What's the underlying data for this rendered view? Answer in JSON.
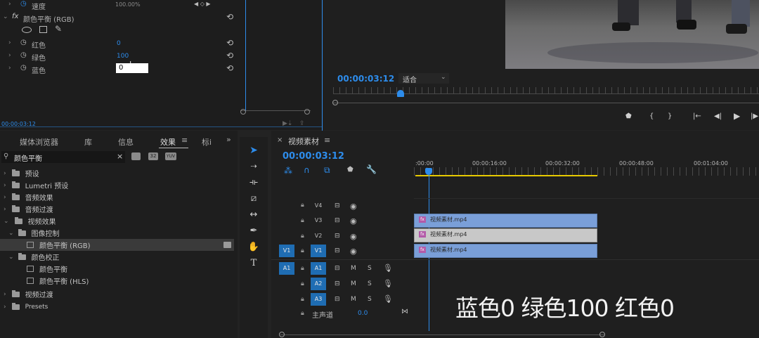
{
  "effect_controls": {
    "speed_label": "速度",
    "speed_value": "100.00%",
    "fx_name": "颜色平衡 (RGB)",
    "params": [
      {
        "label": "红色",
        "value": "0"
      },
      {
        "label": "绿色",
        "value": "100"
      },
      {
        "label": "蓝色",
        "value": "0"
      }
    ],
    "timecode": "00:00:03:12"
  },
  "program_monitor": {
    "timecode": "00:00:03:12",
    "fit_label": "适合"
  },
  "project_panel": {
    "tabs": [
      "媒体浏览器",
      "库",
      "信息",
      "效果",
      "标i"
    ],
    "search_value": "颜色平衡",
    "filter_icons": [
      "32",
      "YUV"
    ],
    "tree": [
      {
        "label": "预设",
        "indent": 0
      },
      {
        "label": "Lumetri 预设",
        "indent": 0
      },
      {
        "label": "音频效果",
        "indent": 0
      },
      {
        "label": "音频过渡",
        "indent": 0
      },
      {
        "label": "视频效果",
        "indent": 0
      },
      {
        "label": "图像控制",
        "indent": 1
      },
      {
        "label": "颜色平衡 (RGB)",
        "indent": 2
      },
      {
        "label": "颜色校正",
        "indent": 1
      },
      {
        "label": "颜色平衡",
        "indent": 2
      },
      {
        "label": "颜色平衡 (HLS)",
        "indent": 2
      },
      {
        "label": "视频过渡",
        "indent": 0
      },
      {
        "label": "Presets",
        "indent": 0
      }
    ]
  },
  "timeline": {
    "tab_title": "视频素材",
    "timecode": "00:00:03:12",
    "ruler": [
      ":00:00",
      "00:00:16:00",
      "00:00:32:00",
      "00:00:48:00",
      "00:01:04:00"
    ],
    "video_tracks": [
      "V4",
      "V3",
      "V2",
      "V1"
    ],
    "src_video": "V1",
    "audio_tracks": [
      "A1",
      "A2",
      "A3"
    ],
    "src_audio": "A1",
    "mute": "M",
    "solo": "S",
    "master_label": "主声道",
    "master_value": "0.0",
    "clips": [
      {
        "name": "视频素材.mp4",
        "color": "#7a9fd8"
      },
      {
        "name": "视频素材.mp4",
        "color": "#c8c8c8"
      },
      {
        "name": "视频素材.mp4",
        "color": "#7a9fd8"
      }
    ]
  },
  "caption": "蓝色0 绿色100 红色0"
}
